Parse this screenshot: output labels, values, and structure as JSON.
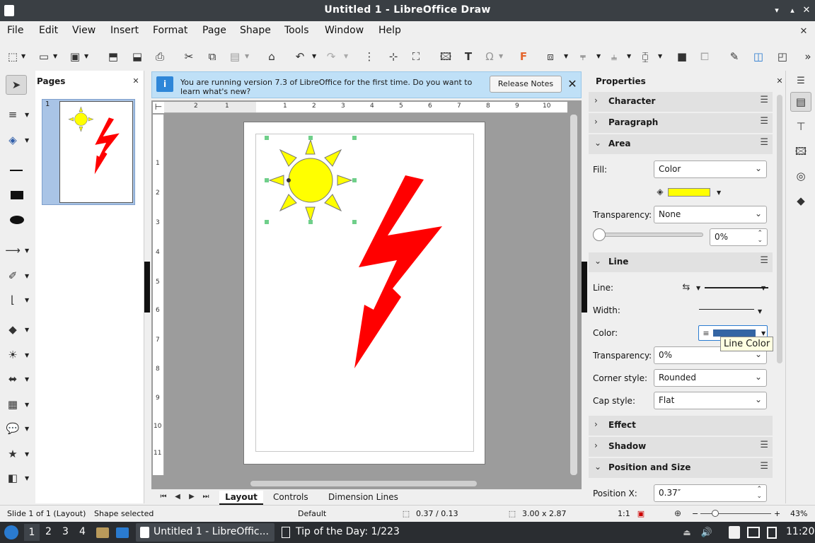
{
  "window": {
    "title": "Untitled 1 - LibreOffice Draw"
  },
  "menu": [
    "File",
    "Edit",
    "View",
    "Insert",
    "Format",
    "Page",
    "Shape",
    "Tools",
    "Window",
    "Help"
  ],
  "pages_panel": {
    "title": "Pages",
    "page_number": "1"
  },
  "infobar": {
    "message": "You are running version 7.3 of LibreOffice for the first time. Do you want to learn what's new?",
    "button": "Release Notes"
  },
  "ruler": {
    "h_left": [
      "2",
      "1"
    ],
    "h_right": [
      "1",
      "2",
      "3",
      "4",
      "5",
      "6",
      "7",
      "8",
      "9",
      "10"
    ],
    "v": [
      "1",
      "2",
      "3",
      "4",
      "5",
      "6",
      "7",
      "8",
      "9",
      "10",
      "11"
    ]
  },
  "tabs": [
    "Layout",
    "Controls",
    "Dimension Lines"
  ],
  "properties": {
    "title": "Properties",
    "sections": {
      "character": "Character",
      "paragraph": "Paragraph",
      "area": "Area",
      "line": "Line",
      "effect": "Effect",
      "shadow": "Shadow",
      "position_size": "Position and Size"
    },
    "area": {
      "fill_label": "Fill:",
      "fill_value": "Color",
      "fill_color": "#ffff00",
      "transparency_label": "Transparency:",
      "transparency_value": "None",
      "transparency_percent": "0%"
    },
    "line": {
      "line_label": "Line:",
      "width_label": "Width:",
      "color_label": "Color:",
      "line_color": "#3465a4",
      "tooltip": "Line Color",
      "transparency_label": "Transparency:",
      "transparency_value": "0%",
      "corner_label": "Corner style:",
      "corner_value": "Rounded",
      "cap_label": "Cap style:",
      "cap_value": "Flat"
    },
    "position": {
      "x_label": "Position X:",
      "x_value": "0.37″"
    }
  },
  "status": {
    "slide": "Slide 1 of 1 (Layout)",
    "selection": "Shape selected",
    "layout": "Default",
    "position": "0.37 / 0.13",
    "size": "3.00 x 2.87",
    "scale": "1:1",
    "zoom": "43%"
  },
  "taskbar": {
    "workspaces": [
      "1",
      "2",
      "3",
      "4"
    ],
    "task1": "Untitled 1 - LibreOffic...",
    "task2": "Tip of the Day: 1/223",
    "clock": "11:20"
  }
}
